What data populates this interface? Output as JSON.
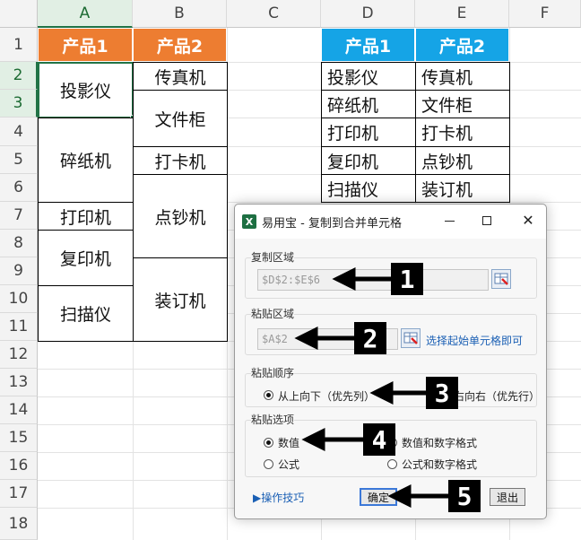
{
  "columns": [
    "A",
    "B",
    "C",
    "D",
    "E",
    "F"
  ],
  "rows": [
    "1",
    "2",
    "3",
    "4",
    "5",
    "6",
    "7",
    "8",
    "9",
    "10",
    "11",
    "12",
    "13",
    "14",
    "15",
    "16",
    "17",
    "18"
  ],
  "table1": {
    "header_a": "产品1",
    "header_b": "产品2",
    "col_a": [
      "投影仪",
      "碎纸机",
      "打印机",
      "复印机",
      "扫描仪"
    ],
    "col_b": [
      "传真机",
      "文件柜",
      "打卡机",
      "点钞机",
      "装订机"
    ]
  },
  "table2": {
    "header_d": "产品1",
    "header_e": "产品2",
    "col_d": [
      "投影仪",
      "碎纸机",
      "打印机",
      "复印机",
      "扫描仪"
    ],
    "col_e": [
      "传真机",
      "文件柜",
      "打卡机",
      "点钞机",
      "装订机"
    ]
  },
  "dialog": {
    "title": "易用宝 - 复制到合并单元格",
    "copy_area_label": "复制区域",
    "copy_area_value": "$D$2:$E$6",
    "paste_area_label": "粘贴区域",
    "paste_area_value": "$A$2",
    "paste_hint": "选择起始单元格即可",
    "order_label": "粘贴顺序",
    "order_opt1": "从上向下（优先列）",
    "order_opt2_visible": "右向右（优先行）",
    "options_label": "粘贴选项",
    "opt_values": "数值",
    "opt_values_numfmt": "数值和数字格式",
    "opt_formula": "公式",
    "opt_formula_numfmt": "公式和数字格式",
    "tips_link": "▶操作技巧",
    "ok": "确定",
    "exit": "退出"
  },
  "callouts": [
    "1",
    "2",
    "3",
    "4",
    "5"
  ],
  "colors": {
    "orange": "#ed7d31",
    "blue": "#15a4e6",
    "excel_green": "#217346",
    "link": "#1a5fb4"
  }
}
